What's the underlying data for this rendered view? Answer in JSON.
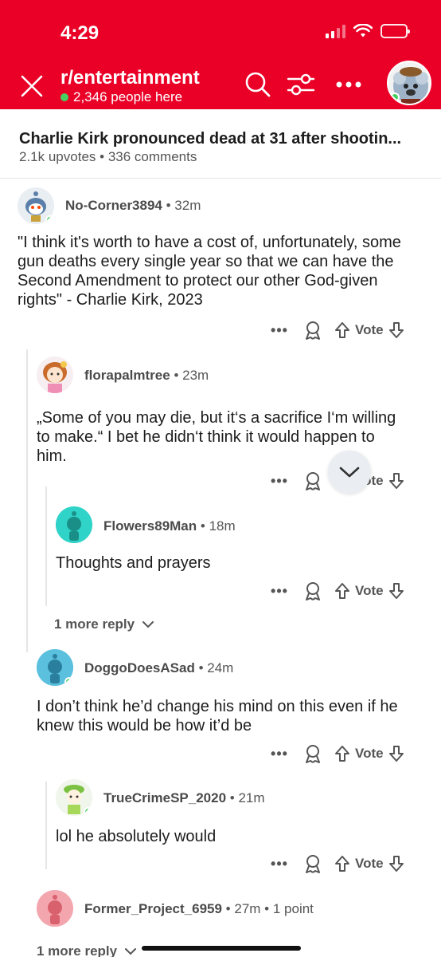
{
  "status": {
    "time": "4:29"
  },
  "header": {
    "subreddit": "r/entertainment",
    "online": "2,346 people here",
    "colors": {
      "brand": "#ea0027",
      "online": "#46d160"
    }
  },
  "post": {
    "title": "Charlie Kirk pronounced dead at 31 after shootin...",
    "upvotes": "2.1k upvotes",
    "separator": "•",
    "comments": "336 comments"
  },
  "vote_label": "Vote",
  "comments": [
    {
      "user": "No-Corner3894",
      "sep": "•",
      "time": "32m",
      "body": "\"I think it's worth to have a cost of, unfortunately, some gun deaths every single year so that we can have the Second Amendment to protect our other God-given rights\" - Charlie Kirk, 2023"
    },
    {
      "user": "florapalmtree",
      "sep": "•",
      "time": "23m",
      "body": "„Some of you may die, but it‘s a sacrifice I‘m willing to make.“ I bet he didn‘t think it would happen to him."
    },
    {
      "user": "Flowers89Man",
      "sep": "•",
      "time": "18m",
      "body": "Thoughts and prayers"
    },
    {
      "user": "DoggoDoesASad",
      "sep": "•",
      "time": "24m",
      "body": "I don’t think he’d change his mind on this even if he knew this would be how it’d be"
    },
    {
      "user": "TrueCrimeSP_2020",
      "sep": "•",
      "time": "21m",
      "body": "lol he absolutely would"
    },
    {
      "user": "Former_Project_6959",
      "sep": "•",
      "time": "27m",
      "points": "1 point"
    }
  ],
  "more_replies": [
    "1 more reply",
    "1 more reply"
  ],
  "icons": [
    "close-icon",
    "search-icon",
    "filter-icon",
    "more-icon",
    "award-icon",
    "upvote-icon",
    "downvote-icon",
    "chevron-down-icon"
  ]
}
